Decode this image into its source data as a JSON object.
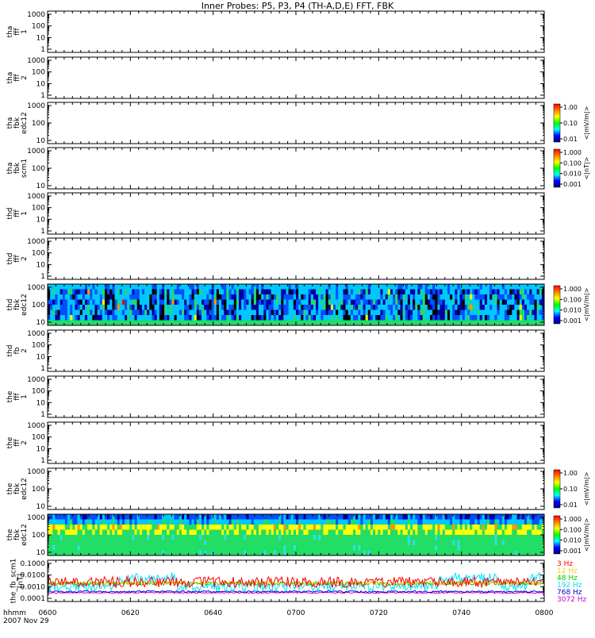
{
  "title": "Inner Probes: P5, P3, P4 (TH-A,D,E) FFT, FBK",
  "time_axis": {
    "row_label": "hhmm",
    "date_label": "2007 Nov 29",
    "ticks": [
      "0600",
      "0620",
      "0640",
      "0700",
      "0720",
      "0740",
      "0800"
    ]
  },
  "colors": {
    "axis": "#000000",
    "spec_black": "#000000",
    "spec_navy": "#0000a0",
    "spec_blue": "#0050ff",
    "spec_cyan": "#00c8ff",
    "spec_cyanlight": "#30e0e0",
    "spec_green": "#22dd66",
    "spec_yellow": "#ffff00",
    "spec_orange": "#ff9900",
    "spec_red": "#ff0000"
  },
  "chart_data": [
    {
      "type": "heatmap",
      "id": "thd-fff-1",
      "ylabel": [
        "tha",
        "fff",
        "1"
      ],
      "yticks": [
        "1000",
        "100",
        "10",
        "1"
      ],
      "empty": true
    },
    {
      "type": "heatmap",
      "id": "thd-fff-2",
      "ylabel": [
        "tha",
        "fff",
        "2"
      ],
      "yticks": [
        "1000",
        "100",
        "10",
        "1"
      ],
      "empty": true
    },
    {
      "type": "heatmap",
      "id": "tha-fbk-edc12",
      "ylabel": [
        "tha",
        "fbk",
        "edc12"
      ],
      "yticks": [
        "1000",
        "100",
        "10"
      ],
      "empty": true,
      "colorbar": {
        "label": "<|mV/m|>",
        "ticks": [
          "1.00",
          "0.10",
          "0.01"
        ]
      }
    },
    {
      "type": "heatmap",
      "id": "tha-fbk-scm1",
      "ylabel": [
        "tha",
        "fbk",
        "scm1"
      ],
      "yticks": [
        "1000",
        "100",
        "10"
      ],
      "empty": true,
      "colorbar": {
        "label": "<|nT|>",
        "ticks": [
          "1.000",
          "0.100",
          "0.010",
          "0.001"
        ]
      }
    },
    {
      "type": "heatmap",
      "id": "thd-fff-1b",
      "ylabel": [
        "thd",
        "fff",
        "1"
      ],
      "yticks": [
        "1000",
        "100",
        "10",
        "1"
      ],
      "empty": true
    },
    {
      "type": "heatmap",
      "id": "thd-fff-2b",
      "ylabel": [
        "thd",
        "fff",
        "2"
      ],
      "yticks": [
        "1000",
        "100",
        "10",
        "1"
      ],
      "empty": true
    },
    {
      "type": "heatmap",
      "id": "thd-fbk-edc12",
      "ylabel": [
        "thd",
        "fbk",
        "edc12"
      ],
      "yticks": [
        "1000",
        "100",
        "10"
      ],
      "empty": false,
      "seed": 7,
      "style": "thd",
      "colorbar": {
        "label": "<|mV/m|>",
        "ticks": [
          "1.000",
          "0.100",
          "0.010",
          "0.001"
        ]
      }
    },
    {
      "type": "heatmap",
      "id": "thd-fb-2",
      "ylabel": [
        "thd",
        "fb",
        "2"
      ],
      "yticks": [
        "1000",
        "100",
        "10",
        "1"
      ],
      "empty": true
    },
    {
      "type": "heatmap",
      "id": "the-fff-1",
      "ylabel": [
        "the",
        "fff",
        "1"
      ],
      "yticks": [
        "1000",
        "100",
        "10",
        "1"
      ],
      "empty": true
    },
    {
      "type": "heatmap",
      "id": "the-fff-2",
      "ylabel": [
        "the",
        "fff",
        "2"
      ],
      "yticks": [
        "1000",
        "100",
        "10",
        "1"
      ],
      "empty": true
    },
    {
      "type": "heatmap",
      "id": "the-fbk-edc12",
      "ylabel": [
        "the",
        "fbk",
        "edc12"
      ],
      "yticks": [
        "1000",
        "100",
        "10"
      ],
      "empty": true,
      "colorbar": {
        "label": "<|mV/m|>",
        "ticks": [
          "1.00",
          "0.10",
          "0.01"
        ]
      }
    },
    {
      "type": "heatmap",
      "id": "the-fbk-edc12b",
      "ylabel": [
        "the",
        "fbk",
        "edc12"
      ],
      "yticks": [
        "1000",
        "100",
        "10"
      ],
      "empty": false,
      "seed": 13,
      "style": "the",
      "colorbar": {
        "label": "<|mV/m|>",
        "ticks": [
          "1.000",
          "0.100",
          "0.010",
          "0.001"
        ]
      }
    },
    {
      "type": "line",
      "id": "the-fb-scm1",
      "ylabel": [
        "the_fb_scm1",
        "[nT]"
      ],
      "yticks": [
        "0.1000",
        "0.0100",
        "0.0010",
        "0.0001"
      ],
      "ylim": [
        0.0001,
        0.1
      ],
      "yscale": "log",
      "series": [
        {
          "name": "3 Hz",
          "color": "#ff0000",
          "base": 0.0025,
          "jitter": 0.9
        },
        {
          "name": "12 Hz",
          "color": "#ffcc00",
          "base": 0.002,
          "jitter": 0.3
        },
        {
          "name": "48 Hz",
          "color": "#00cc00",
          "base": 0.0019,
          "jitter": 0.3
        },
        {
          "name": "192 Hz",
          "color": "#00e0ff",
          "base": 0.0011,
          "jitter": 0.9
        },
        {
          "name": "768 Hz",
          "color": "#0000cc",
          "base": 0.00038,
          "jitter": 0.15
        },
        {
          "name": "3072 Hz",
          "color": "#cc00cc",
          "base": 0.0003,
          "jitter": 0.1
        }
      ]
    }
  ]
}
